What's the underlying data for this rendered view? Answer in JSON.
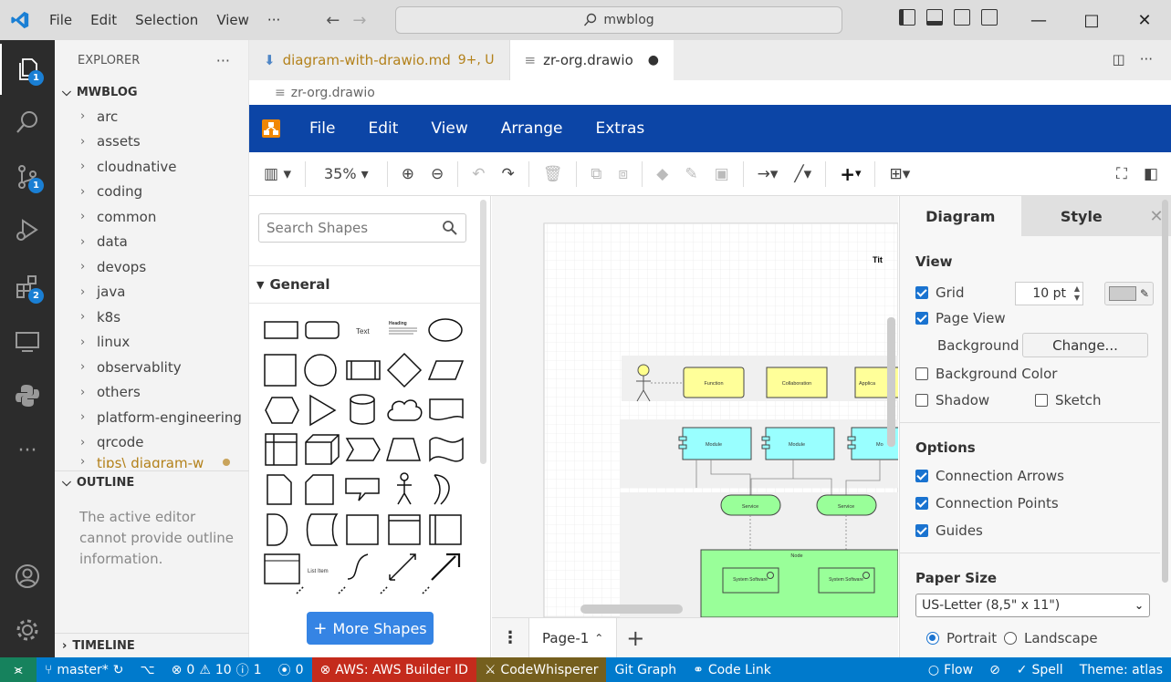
{
  "titlebar": {
    "menus": [
      "File",
      "Edit",
      "Selection",
      "View",
      "···"
    ],
    "search": "mwblog"
  },
  "activity": {
    "explorer_badge": "1",
    "scm_badge": "1",
    "extensions_badge": "2"
  },
  "sidebar": {
    "header": "EXPLORER",
    "more": "···",
    "root": "MWBLOG",
    "folders": [
      "arc",
      "assets",
      "cloudnative",
      "coding",
      "common",
      "data",
      "devops",
      "java",
      "k8s",
      "linux",
      "observablity",
      "others",
      "platform-engineering",
      "qrcode",
      "tips\\ diagram-w"
    ],
    "outline_title": "OUTLINE",
    "outline_msg": "The active editor cannot provide outline information.",
    "timeline_title": "TIMELINE"
  },
  "tabs": [
    {
      "label": "diagram-with-drawio.md",
      "suffix": "9+, U"
    },
    {
      "label": "zr-org.drawio",
      "suffix": "●"
    }
  ],
  "breadcrumb": "zr-org.drawio",
  "drawio": {
    "menus": [
      "File",
      "Edit",
      "View",
      "Arrange",
      "Extras"
    ],
    "zoom": "35%",
    "search_placeholder": "Search Shapes",
    "general": "General",
    "more_shapes": "More Shapes",
    "page_tab": "Page-1",
    "canvas": {
      "title_fragment": "Tit",
      "function": "Function",
      "collaboration": "Collaboration",
      "application": "Applica",
      "module": "Module",
      "module_fragment": "Mo",
      "service": "Service",
      "node": "Node",
      "system_software": "System Software",
      "text_shape": "Text",
      "heading_shape": "Heading",
      "list_item": "List Item"
    }
  },
  "format": {
    "tab_diagram": "Diagram",
    "tab_style": "Style",
    "view_h": "View",
    "grid": "Grid",
    "grid_size": "10 pt",
    "page_view": "Page View",
    "background": "Background",
    "change": "Change...",
    "background_color": "Background Color",
    "shadow": "Shadow",
    "sketch": "Sketch",
    "options_h": "Options",
    "connection_arrows": "Connection Arrows",
    "connection_points": "Connection Points",
    "guides": "Guides",
    "paper_size_h": "Paper Size",
    "paper_size": "US-Letter (8,5\" x 11\")",
    "portrait": "Portrait",
    "landscape": "Landscape"
  },
  "status": {
    "branch": "master*",
    "errors": "0",
    "warnings": "10",
    "info": "1",
    "ports": "0",
    "aws": "AWS: AWS Builder ID",
    "codewhisperer": "CodeWhisperer",
    "gitgraph": "Git Graph",
    "codelink": "Code Link",
    "flow": "Flow",
    "spell": "Spell",
    "theme": "Theme: atlas"
  }
}
